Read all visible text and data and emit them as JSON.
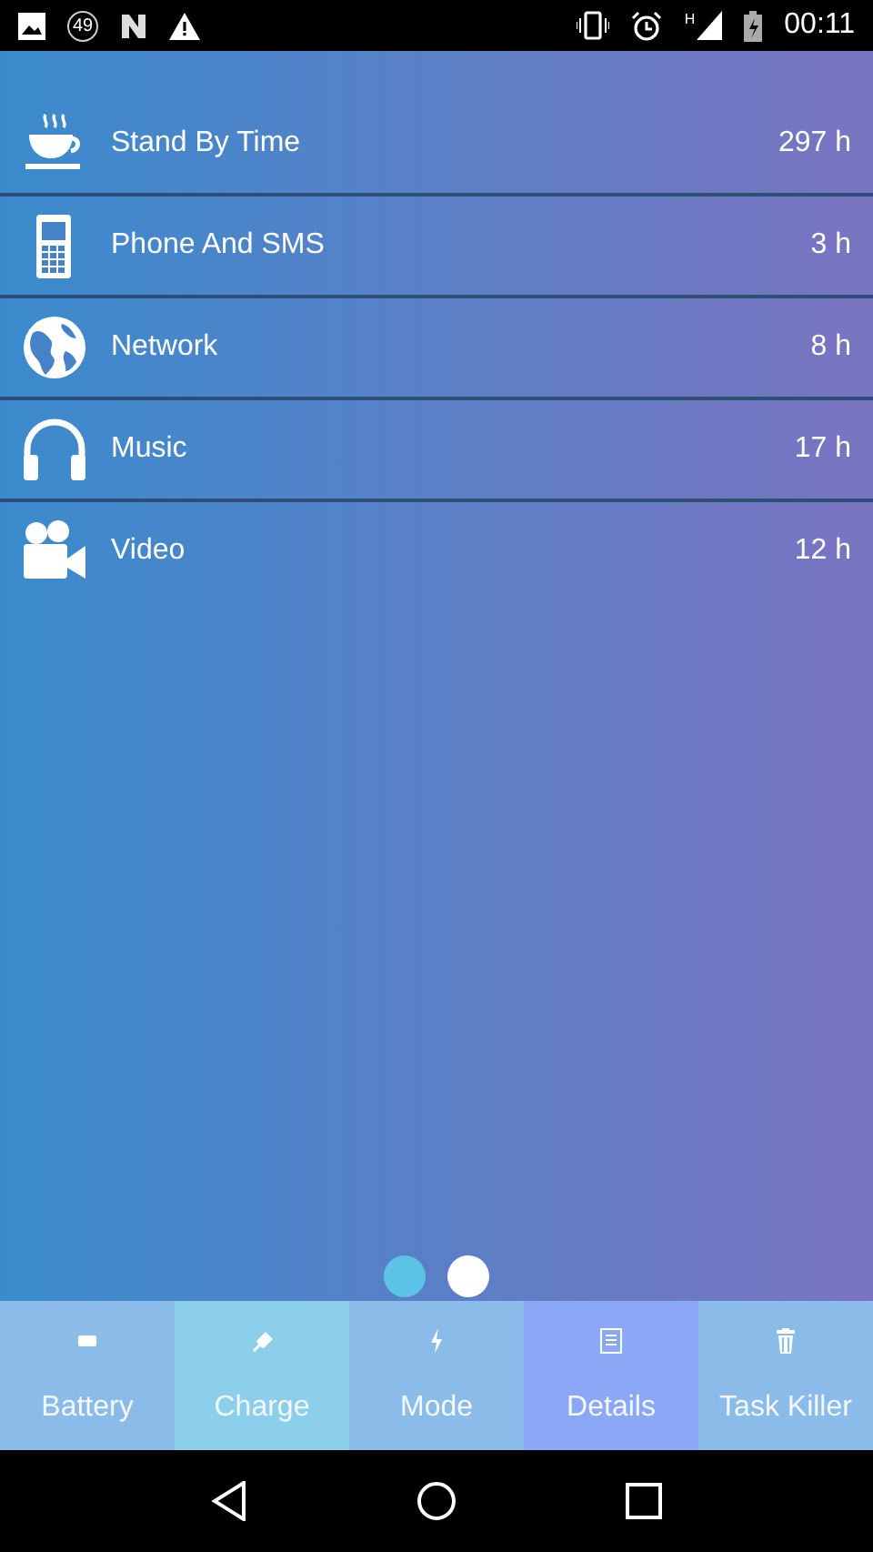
{
  "status_bar": {
    "badge": "49",
    "time": "00:11",
    "network_type": "H"
  },
  "items": [
    {
      "kind": "cup",
      "label": "Stand By Time",
      "value": "297 h"
    },
    {
      "kind": "phone",
      "label": "Phone And SMS",
      "value": "3 h"
    },
    {
      "kind": "globe",
      "label": "Network",
      "value": "8 h"
    },
    {
      "kind": "headphones",
      "label": "Music",
      "value": "17 h"
    },
    {
      "kind": "camera",
      "label": "Video",
      "value": "12 h"
    }
  ],
  "pager": [
    {
      "selected": true
    },
    {
      "selected": false
    }
  ],
  "tabs": [
    {
      "kind": "battery",
      "label": "Battery",
      "color": "#8bbbe9"
    },
    {
      "kind": "plug",
      "label": "Charge",
      "color": "#8ccfea"
    },
    {
      "kind": "bolt",
      "label": "Mode",
      "color": "#8bbbe9"
    },
    {
      "kind": "document",
      "label": "Details",
      "color": "#8aa8f6"
    },
    {
      "kind": "trash",
      "label": "Task Killer",
      "color": "#8bbbe9"
    }
  ]
}
